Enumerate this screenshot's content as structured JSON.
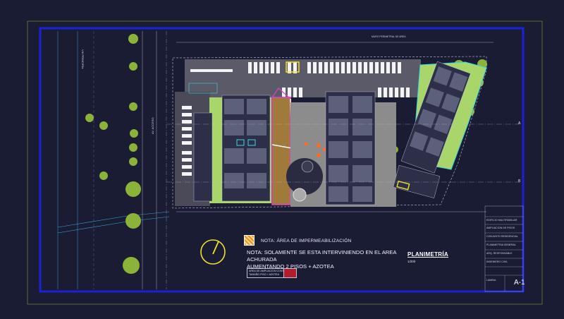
{
  "drawing": {
    "legend_title": "NOTA: ÁREA DE IMPERMEABILIZACIÓN",
    "note_line_1": "NOTA: SOLAMENTE SE ESTA INTERVINIENDO EN EL AREA ACHURADA",
    "note_line_2": "AUMENTANDO 2 PISOS + AZOTEA",
    "area_box_line_1": "AREA DE AMPLIACION CONTE.",
    "area_box_line_2": "TAMAÑO PISO + AZOTEA",
    "plan_title": "PLANIMETRÍA",
    "plan_scale": "1/200",
    "sheet_code": "A-1",
    "street_label_1": "VIA PRINCIPAL",
    "street_label_2": "AV. ACCESO",
    "axis_a": "A",
    "axis_b": "B",
    "top_label": "MURO PERIMETRAL DE AREA"
  },
  "title_block": {
    "rows": [
      "EDIFICIO MULTIFAMILIAR",
      "AMPLIACION DE PISOS",
      "CONJUNTO RESIDENCIAL",
      "PLANIMETRIA GENERAL",
      "ARQ. RESPONSABLE",
      "INGENIERO CIVIL",
      "LAMINA"
    ]
  },
  "colors": {
    "background": "#1a1c33",
    "border_blue": "#1b22d6",
    "outer_border": "#8a9a3a",
    "hatch_area": "#a07a3a",
    "magenta": "#e040c8",
    "green_area": "#a9d66b",
    "grey_slab": "#8c8c8c",
    "cyan": "#3ad6e0",
    "yellow": "#f2e02a"
  }
}
